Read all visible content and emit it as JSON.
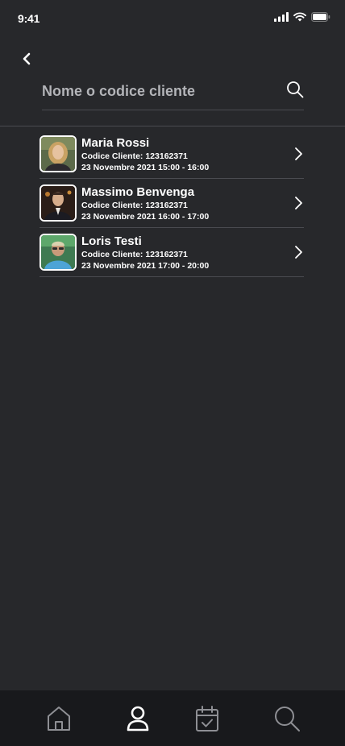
{
  "status_bar": {
    "time": "9:41"
  },
  "search": {
    "placeholder": "Nome o codice cliente"
  },
  "clients": [
    {
      "name": "Maria Rossi",
      "code": "Codice Cliente: 123162371",
      "slot": "23 Novembre 2021 15:00 - 16:00"
    },
    {
      "name": "Massimo Benvenga",
      "code": "Codice Cliente: 123162371",
      "slot": "23 Novembre 2021 16:00 - 17:00"
    },
    {
      "name": "Loris Testi",
      "code": "Codice Cliente: 123162371",
      "slot": "23 Novembre 2021 17:00 - 20:00"
    }
  ],
  "bottom_nav": {
    "items": [
      {
        "icon": "home-icon",
        "active": false
      },
      {
        "icon": "user-icon",
        "active": true
      },
      {
        "icon": "calendar-check-icon",
        "active": false
      },
      {
        "icon": "search-icon",
        "active": false
      }
    ]
  },
  "colors": {
    "background": "#27282b",
    "nav_background": "#18191c",
    "divider": "#4a4b50",
    "inactive_icon": "#8e8f94",
    "active_icon": "#ffffff"
  }
}
